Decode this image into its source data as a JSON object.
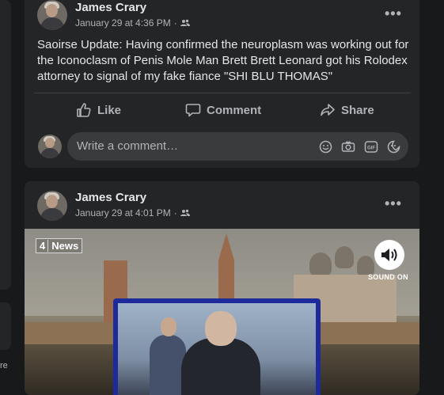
{
  "left_edge_text": "re",
  "posts": [
    {
      "author": "James Crary",
      "timestamp": "January 29 at 4:36 PM",
      "privacy_icon": "friends-icon",
      "more_label": "•••",
      "text": "Saoirse Update:  Having confirmed the neuroplasm was working out for the Iconoclasm of Penis Mole Man Brett Brett Leonard got his Rolodex attorney to signal of my fake fiance \"SHI BLU THOMAS\"",
      "actions": {
        "like": "Like",
        "comment": "Comment",
        "share": "Share"
      },
      "comment_placeholder": "Write a comment…"
    },
    {
      "author": "James Crary",
      "timestamp": "January 29 at 4:01 PM",
      "privacy_icon": "friends-icon",
      "more_label": "•••",
      "video": {
        "channel_number": "4",
        "channel_name": "News",
        "sound_label": "SOUND ON"
      }
    }
  ],
  "colors": {
    "background": "#18191a",
    "card": "#242526",
    "input": "#3a3b3c",
    "text_primary": "#e4e6eb",
    "text_secondary": "#b0b3b8"
  }
}
